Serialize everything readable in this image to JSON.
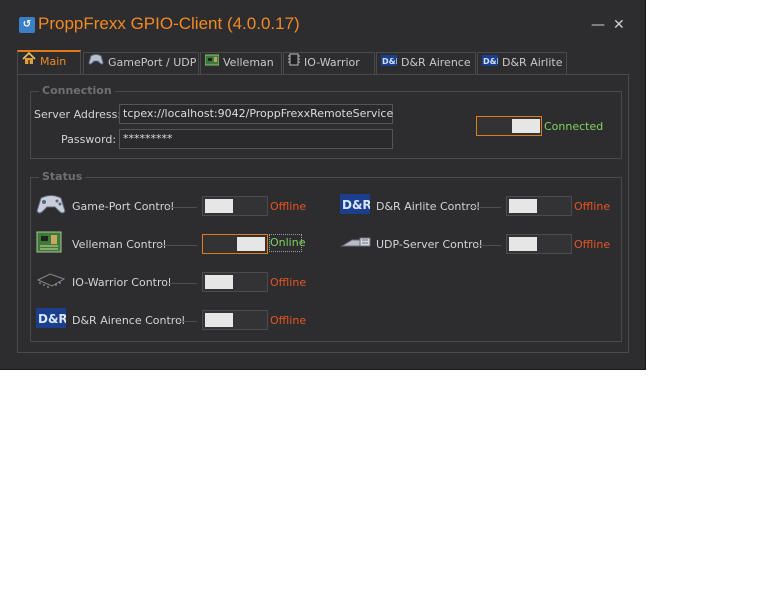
{
  "window": {
    "title": "ProppFrexx GPIO-Client (4.0.0.17)",
    "minimize_glyph": "—",
    "close_glyph": "✕",
    "accent_color": "#f08a24"
  },
  "tabs": [
    {
      "label": "Main",
      "icon": "home-icon",
      "active": true
    },
    {
      "label": "GamePort / UDP",
      "icon": "gamepad-icon",
      "active": false
    },
    {
      "label": "Velleman",
      "icon": "circuit-board-icon",
      "active": false
    },
    {
      "label": "IO-Warrior",
      "icon": "chip-icon",
      "active": false
    },
    {
      "label": "D&R Airence",
      "icon": "dr-logo-icon",
      "active": false
    },
    {
      "label": "D&R Airlite",
      "icon": "dr-logo-icon",
      "active": false
    }
  ],
  "connection": {
    "group_title": "Connection",
    "server_label": "Server Address:",
    "server_value": "tcpex://localhost:9042/ProppFrexxRemoteService",
    "password_label": "Password:",
    "password_value": "*********",
    "toggle_on": true,
    "status": "Connected"
  },
  "status": {
    "group_title": "Status",
    "devices": {
      "gameport": {
        "label": "Game-Port Control",
        "state": "Offline",
        "on": false,
        "icon": "gamepad-icon"
      },
      "velleman": {
        "label": "Velleman Control",
        "state": "Online",
        "on": true,
        "icon": "circuit-board-icon"
      },
      "iowarrior": {
        "label": "IO-Warrior Control",
        "state": "Offline",
        "on": false,
        "icon": "chip-icon"
      },
      "airence": {
        "label": "D&R Airence Control",
        "state": "Offline",
        "on": false,
        "icon": "dr-logo-icon"
      },
      "airlite": {
        "label": "D&R Airlite Control",
        "state": "Offline",
        "on": false,
        "icon": "dr-logo-icon"
      },
      "udp": {
        "label": "UDP-Server Control",
        "state": "Offline",
        "on": false,
        "icon": "network-plug-icon"
      }
    }
  },
  "colors": {
    "offline": "#e8551f",
    "online": "#7fd35e",
    "connected": "#7fd35e"
  }
}
